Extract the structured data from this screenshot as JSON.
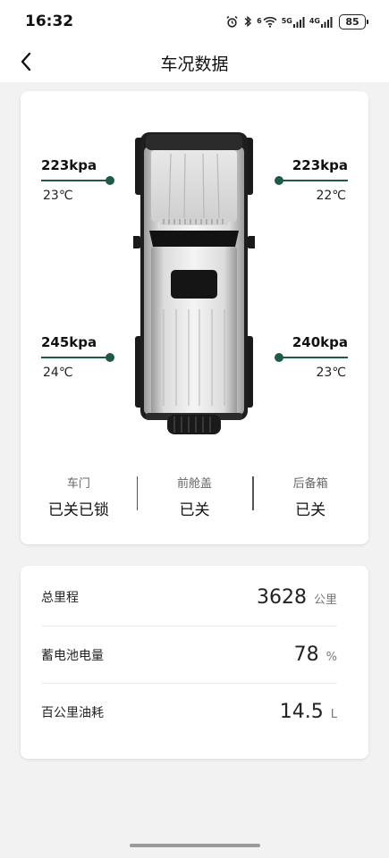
{
  "status_bar": {
    "time": "16:32",
    "net_wifi": "6",
    "net_1": "5G",
    "net_2": "4G",
    "battery": "85"
  },
  "header": {
    "title": "车况数据"
  },
  "tires": {
    "front_left": {
      "pressure": "223kpa",
      "temp": "23℃"
    },
    "front_right": {
      "pressure": "223kpa",
      "temp": "22℃"
    },
    "rear_left": {
      "pressure": "245kpa",
      "temp": "24℃"
    },
    "rear_right": {
      "pressure": "240kpa",
      "temp": "23℃"
    }
  },
  "doors": [
    {
      "label": "车门",
      "value": "已关已锁"
    },
    {
      "label": "前舱盖",
      "value": "已关"
    },
    {
      "label": "后备箱",
      "value": "已关"
    }
  ],
  "stats": [
    {
      "label": "总里程",
      "value": "3628",
      "unit": "公里"
    },
    {
      "label": "蓄电池电量",
      "value": "78",
      "unit": "%"
    },
    {
      "label": "百公里油耗",
      "value": "14.5",
      "unit": "L"
    }
  ],
  "colors": {
    "accent": "#1f5a47",
    "background": "#f2f2f2",
    "card": "#ffffff"
  }
}
